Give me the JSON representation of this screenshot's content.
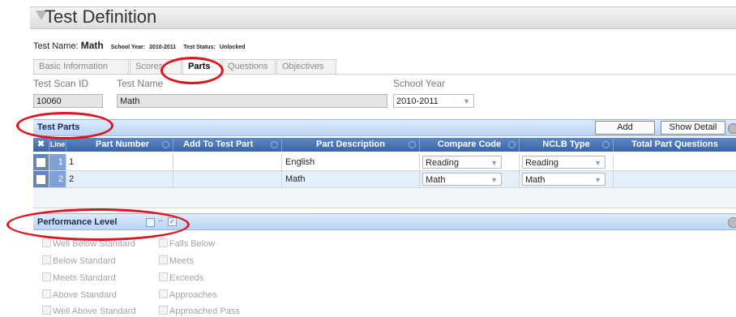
{
  "header": {
    "title": "Test Definition"
  },
  "test_info": {
    "name_label": "Test Name:",
    "name_value": "Math",
    "school_year_label": "School Year:",
    "school_year_value": "2010-2011",
    "status_label": "Test Status:",
    "status_value": "Unlocked"
  },
  "tabs": [
    {
      "label": "Basic Information",
      "active": false
    },
    {
      "label": "Scores",
      "active": false
    },
    {
      "label": "Parts",
      "active": true
    },
    {
      "label": "Questions",
      "active": false
    },
    {
      "label": "Objectives",
      "active": false
    }
  ],
  "fields": {
    "scan_id_label": "Test Scan ID",
    "scan_id_value": "10060",
    "test_name_label": "Test Name",
    "test_name_value": "Math",
    "school_year_label": "School Year",
    "school_year_value": "2010-2011"
  },
  "test_parts": {
    "title": "Test Parts",
    "add_label": "Add",
    "show_detail_label": "Show Detail",
    "columns": [
      "Line",
      "Part Number",
      "Add To Test Part",
      "Part Description",
      "Compare Code",
      "NCLB Type",
      "Total Part Questions"
    ],
    "rows": [
      {
        "line": "1",
        "part_number": "1",
        "add_to": "",
        "description": "English",
        "compare_code": "Reading",
        "nclb_type": "Reading",
        "total": ""
      },
      {
        "line": "2",
        "part_number": "2",
        "add_to": "",
        "description": "Math",
        "compare_code": "Math",
        "nclb_type": "Math",
        "total": ""
      }
    ]
  },
  "performance_level": {
    "title": "Performance Level",
    "left_items": [
      "Well Below Standard",
      "Below Standard",
      "Meets Standard",
      "Above Standard",
      "Well Above Standard"
    ],
    "right_items": [
      "Falls Below",
      "Meets",
      "Exceeds",
      "Approaches",
      "Approached Pass"
    ]
  },
  "colors": {
    "header_blue": "#3c64a6",
    "section_blue": "#b9d4f4",
    "annotation_red": "#e0141e"
  }
}
